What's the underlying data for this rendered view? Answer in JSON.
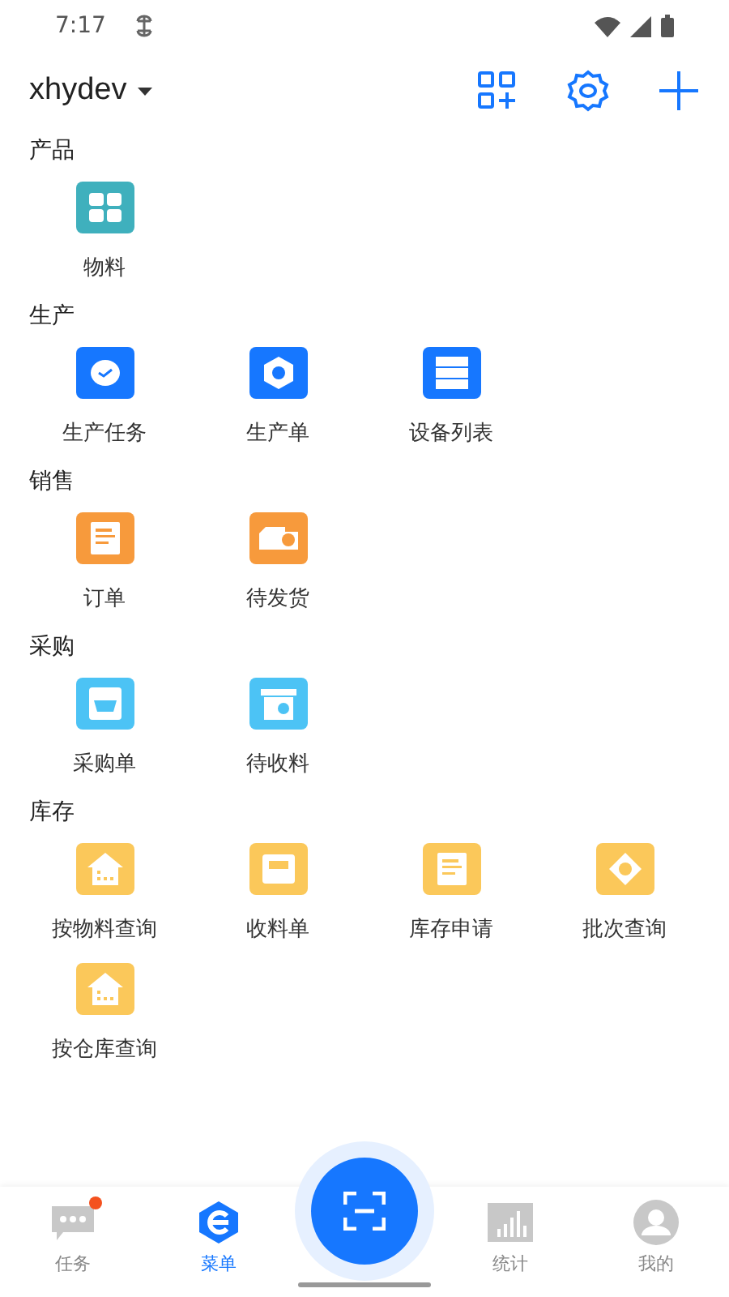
{
  "status_bar": {
    "time": "7:17"
  },
  "header": {
    "account": "xhydev"
  },
  "sections": [
    {
      "title": "产品",
      "color": "#3fb0bd",
      "items": [
        {
          "label": "物料"
        }
      ]
    },
    {
      "title": "生产",
      "color": "#1677ff",
      "items": [
        {
          "label": "生产任务"
        },
        {
          "label": "生产单"
        },
        {
          "label": "设备列表"
        }
      ]
    },
    {
      "title": "销售",
      "color": "#f79a3c",
      "items": [
        {
          "label": "订单"
        },
        {
          "label": "待发货"
        }
      ]
    },
    {
      "title": "采购",
      "color": "#4cc3f5",
      "items": [
        {
          "label": "采购单"
        },
        {
          "label": "待收料"
        }
      ]
    },
    {
      "title": "库存",
      "color": "#fbc85a",
      "items": [
        {
          "label": "按物料查询"
        },
        {
          "label": "收料单"
        },
        {
          "label": "库存申请"
        },
        {
          "label": "批次查询"
        },
        {
          "label": "按仓库查询"
        }
      ]
    }
  ],
  "tabs": [
    {
      "kind": "chat",
      "label": "任务",
      "selected": false,
      "badge": true
    },
    {
      "kind": "menu",
      "label": "菜单",
      "selected": true,
      "badge": false
    },
    {
      "kind": "scan"
    },
    {
      "kind": "stats",
      "label": "统计",
      "selected": false,
      "badge": false
    },
    {
      "kind": "me",
      "label": "我的",
      "selected": false,
      "badge": false
    }
  ]
}
